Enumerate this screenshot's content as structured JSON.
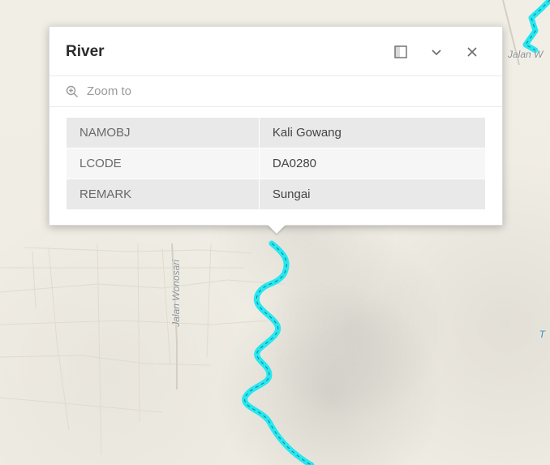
{
  "popup": {
    "title": "River",
    "zoom_label": "Zoom to",
    "attributes": [
      {
        "key": "NAMOBJ",
        "value": "Kali Gowang"
      },
      {
        "key": "LCODE",
        "value": "DA0280"
      },
      {
        "key": "REMARK",
        "value": "Sungai"
      }
    ]
  },
  "map": {
    "labels": {
      "road_wonosari_vertical": "Jalan Wonosari",
      "road_top_right_partial": "Jalan W",
      "river_partial": "T"
    }
  },
  "colors": {
    "highlight": "#26e7f0",
    "terrain": "#efece3",
    "roadline": "#d6d3cc",
    "text_muted": "#9a9a9a"
  }
}
